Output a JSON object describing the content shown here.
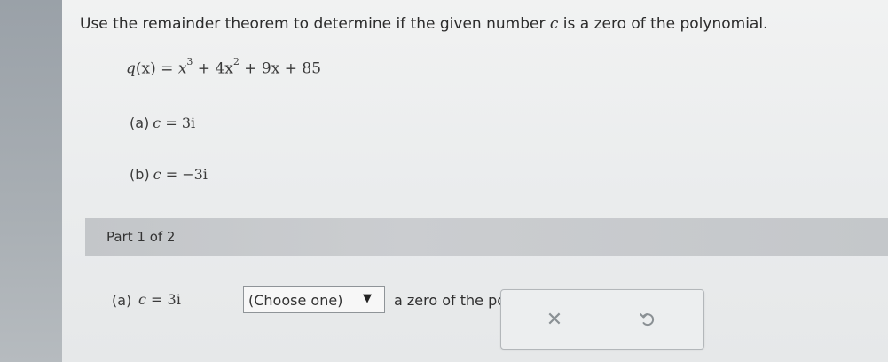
{
  "question": {
    "instruction_prefix": "Use the remainder theorem to determine if the given number ",
    "instruction_var": "c",
    "instruction_suffix": " is a zero of the polynomial.",
    "polynomial": {
      "fname": "q",
      "arg": "(x)",
      "eq": " = ",
      "t1": "x",
      "t1_exp": "3",
      "t2": " + 4x",
      "t2_exp": "2",
      "t3": " + 9x + 85"
    },
    "parts": [
      {
        "label": "(a)",
        "var": "c",
        "value": " = 3i"
      },
      {
        "label": "(b)",
        "var": "c",
        "value": " = −3i"
      }
    ]
  },
  "part_bar": {
    "label": "Part 1 of 2"
  },
  "answer": {
    "label": "(a)",
    "var": "c",
    "value": " = 3i",
    "dropdown_selected": "(Choose one)",
    "dropdown_arrow": "▼",
    "after_text": "a zero of the polynomial."
  },
  "actions": {
    "clear_symbol": "✕",
    "clear_icon": "close-icon",
    "undo_icon": "undo-icon"
  },
  "colors": {
    "part_bar": "#c6c9cc",
    "background": "#eceeef"
  }
}
